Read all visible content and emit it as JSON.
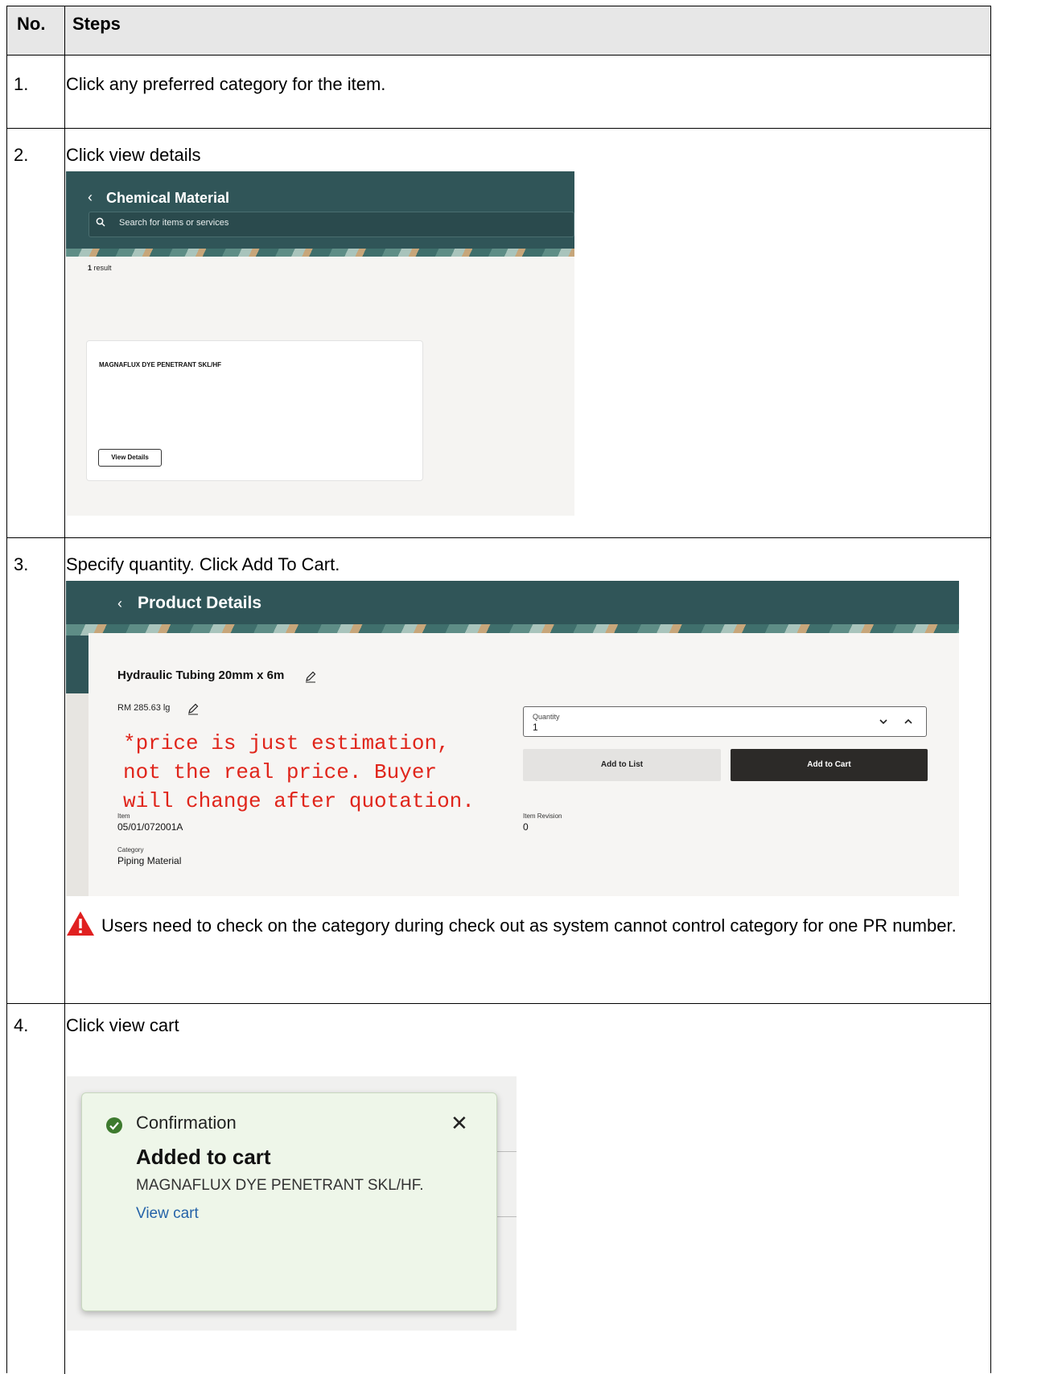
{
  "table": {
    "headers": {
      "no": "No.",
      "steps": "Steps"
    },
    "rows": [
      {
        "no": "1.",
        "step": "Click any preferred category for the item."
      },
      {
        "no": "2.",
        "step": "Click view details"
      },
      {
        "no": "3.",
        "step": "Specify quantity. Click Add To Cart."
      },
      {
        "no": "4.",
        "step": "Click view cart"
      }
    ]
  },
  "screen_category": {
    "title": "Chemical Material",
    "search_placeholder": "Search for items or services",
    "result_count": "1",
    "result_label": "result",
    "card_title": "MAGNAFLUX DYE PENETRANT SKL/HF",
    "view_details": "View Details"
  },
  "screen_product": {
    "title": "Product Details",
    "product_name": "Hydraulic Tubing 20mm x 6m",
    "price": "RM 285.63 lg",
    "price_note": "*price is just estimation,\nnot the real price. Buyer\nwill change after quotation.",
    "quantity_label": "Quantity",
    "quantity_value": "1",
    "add_to_list": "Add to List",
    "add_to_cart": "Add to Cart",
    "item_label": "Item",
    "item_value": "05/01/072001A",
    "item_revision_label": "Item Revision",
    "item_revision_value": "0",
    "category_label": "Category",
    "category_value": "Piping Material"
  },
  "warning": {
    "text": "Users need to check on the category during check out as system cannot control category for one PR number."
  },
  "screen_cart": {
    "header": "Confirmation",
    "title": "Added to cart",
    "item": "MAGNAFLUX DYE PENETRANT SKL/HF.",
    "link": "View cart"
  },
  "colors": {
    "header_bar": "#305558",
    "price_note": "#e0251b",
    "link": "#2563a8",
    "warning": "#e02020"
  }
}
